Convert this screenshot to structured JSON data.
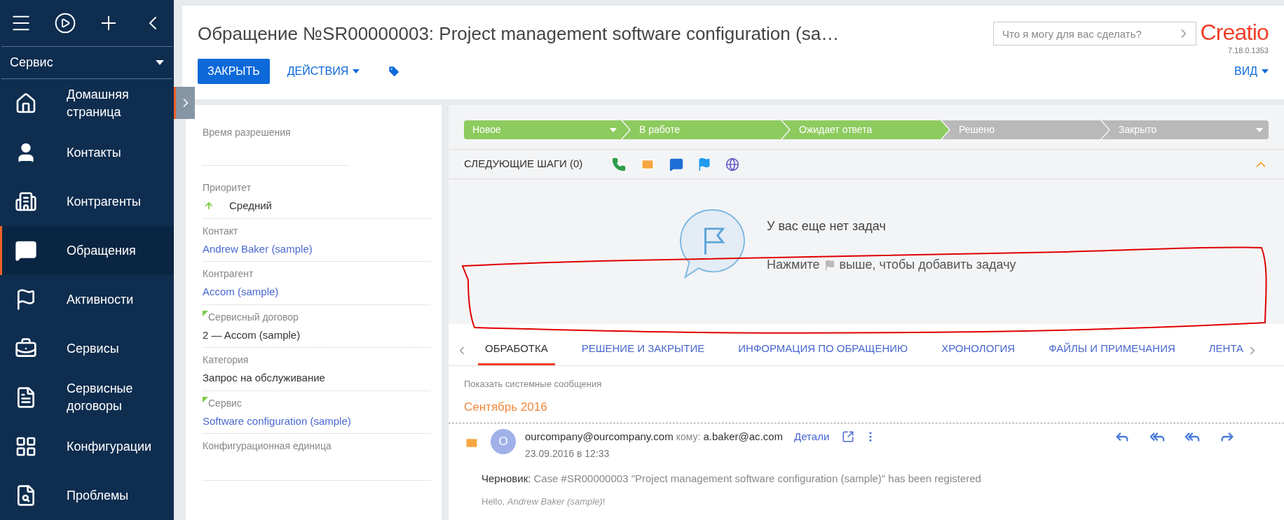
{
  "sidebar": {
    "workplace": "Сервис",
    "items": [
      {
        "label": "Домашняя страница",
        "selected": false
      },
      {
        "label": "Контакты",
        "selected": false
      },
      {
        "label": "Контрагенты",
        "selected": false
      },
      {
        "label": "Обращения",
        "selected": true
      },
      {
        "label": "Активности",
        "selected": false
      },
      {
        "label": "Сервисы",
        "selected": false
      },
      {
        "label": "Сервисные договоры",
        "selected": false
      },
      {
        "label": "Конфигурации",
        "selected": false
      },
      {
        "label": "Проблемы",
        "selected": false
      }
    ]
  },
  "header": {
    "title": "Обращение №SR00000003: Project management software configuration (sa…",
    "search": {
      "placeholder": "Что я могу для вас сделать?"
    },
    "logo": "Creatio",
    "version": "7.18.0.1353",
    "close_button": "ЗАКРЫТЬ",
    "actions_button": "ДЕЙСТВИЯ",
    "view_button": "ВИД"
  },
  "fields": [
    {
      "label": "Время разрешения",
      "kind": "empty",
      "flagged": false
    },
    {
      "label": "Приоритет",
      "value": "Средний",
      "kind": "priority",
      "flagged": false
    },
    {
      "label": "Контакт",
      "value": "Andrew Baker (sample)",
      "kind": "link",
      "flagged": false
    },
    {
      "label": "Контрагент",
      "value": "Accom (sample)",
      "kind": "link",
      "flagged": false
    },
    {
      "label": "Сервисный договор",
      "value": "2 — Accom (sample)",
      "kind": "text",
      "flagged": true
    },
    {
      "label": "Категория",
      "value": "Запрос на обслуживание",
      "kind": "text",
      "flagged": false
    },
    {
      "label": "Сервис",
      "value": "Software configuration (sample)",
      "kind": "link",
      "flagged": true
    },
    {
      "label": "Конфигурационная единица",
      "kind": "empty",
      "flagged": false
    }
  ],
  "stages": [
    {
      "label": "Новое",
      "completed": true,
      "menu": true
    },
    {
      "label": "В работе",
      "completed": true,
      "menu": false
    },
    {
      "label": "Ожидает ответа",
      "completed": true,
      "menu": false
    },
    {
      "label": "Решено",
      "completed": false,
      "menu": false
    },
    {
      "label": "Закрыто",
      "completed": false,
      "menu": true
    }
  ],
  "next_steps": {
    "title": "СЛЕДУЮЩИЕ ШАГИ (0)",
    "expanded": true,
    "empty_title": "У вас еще нет задач",
    "hint_before": "Нажмите",
    "hint_after": "выше, чтобы добавить задачу"
  },
  "tabs": [
    {
      "label": "ОБРАБОТКА",
      "selected": true
    },
    {
      "label": "РЕШЕНИЕ И ЗАКРЫТИЕ",
      "selected": false
    },
    {
      "label": "ИНФОРМАЦИЯ ПО ОБРАЩЕНИЮ",
      "selected": false
    },
    {
      "label": "ХРОНОЛОГИЯ",
      "selected": false
    },
    {
      "label": "ФАЙЛЫ И ПРИМЕЧАНИЯ",
      "selected": false
    },
    {
      "label": "ЛЕНТА",
      "selected": false
    }
  ],
  "feed": {
    "show_system": "Показать системные сообщения",
    "month": "Сентябрь 2016",
    "email": {
      "avatar": "O",
      "from": "ourcompany@ourcompany.com",
      "to_label": "кому:",
      "to": "a.baker@ac.com",
      "details": "Детали",
      "date": "23.09.2016 в 12:33",
      "draft_label": "Черновик:",
      "subject": "Case #SR00000003 \"Project management software configuration (sample)\" has been registered",
      "body": "Hello, *Andrew Baker (sample)*!"
    }
  }
}
